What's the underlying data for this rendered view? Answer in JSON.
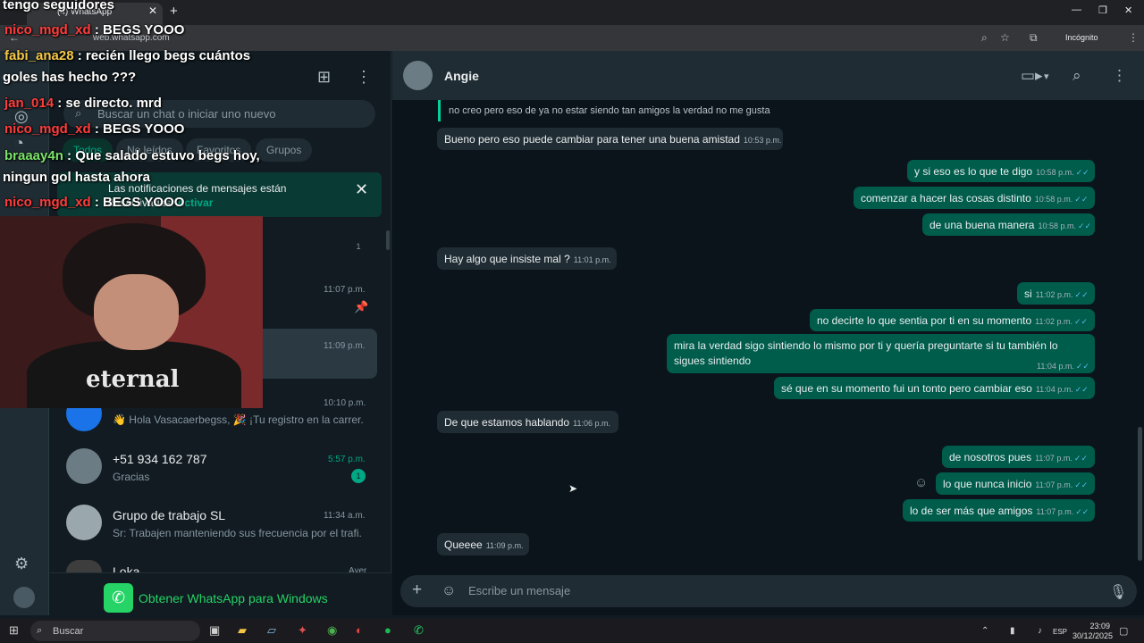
{
  "browser": {
    "tab_title": "(4) WhatsApp",
    "url": "web.whatsapp.com",
    "incognito_label": "Incógnito"
  },
  "sidebar": {
    "search_placeholder": "Buscar un chat o iniciar uno nuevo",
    "filters": [
      "Todos",
      "No leídos",
      "Favoritos",
      "Grupos"
    ],
    "notification": {
      "text": "Las notificaciones de mensajes están",
      "text2": "desactivadas.",
      "action": "Activar"
    },
    "chats": [
      {
        "time": "",
        "badge": "1"
      },
      {
        "time": "11:07 p.m."
      },
      {
        "time": "11:09 p.m."
      },
      {
        "time": "10:10 p.m.",
        "message": "👋 Hola Vasacaerbegss, 🎉 ¡Tu registro en la carrer..."
      },
      {
        "name": "+51 934 162 787",
        "time": "5:57 p.m.",
        "message": "Gracias",
        "badge": "1"
      },
      {
        "name": "Grupo de trabajo SL",
        "time": "11:34 a.m.",
        "message": "Sr: Trabajen manteniendo sus frecuencia por el trafi..."
      },
      {
        "name": "Loka",
        "time": "Ayer"
      }
    ],
    "get_app": "Obtener WhatsApp para Windows"
  },
  "conversation": {
    "contact_name": "Angie",
    "quoted": "no creo pero eso de ya no estar siendo tan amigos la verdad no me gusta",
    "messages": [
      {
        "dir": "in",
        "text": "Bueno pero eso puede cambiar para tener una buena amistad",
        "time": "10:53 p.m."
      },
      {
        "dir": "out",
        "text": "y si eso es lo que te digo",
        "time": "10:58 p.m."
      },
      {
        "dir": "out",
        "text": "comenzar a hacer las cosas distinto",
        "time": "10:58 p.m."
      },
      {
        "dir": "out",
        "text": "de una buena manera",
        "time": "10:58 p.m."
      },
      {
        "dir": "in",
        "text": "Hay algo que insiste mal ?",
        "time": "11:01 p.m."
      },
      {
        "dir": "out",
        "text": "si",
        "time": "11:02 p.m."
      },
      {
        "dir": "out",
        "text": "no decirte lo que sentia por ti en su momento",
        "time": "11:02 p.m."
      },
      {
        "dir": "out",
        "text": "mira la verdad sigo sintiendo lo mismo por ti y quería preguntarte si tu también lo",
        "text2": "sigues sintiendo",
        "time": "11:04 p.m."
      },
      {
        "dir": "out",
        "text": "sé que en su momento fui un tonto pero cambiar eso",
        "time": "11:04 p.m."
      },
      {
        "dir": "in",
        "text": "De que estamos hablando",
        "time": "11:06 p.m."
      },
      {
        "dir": "out",
        "text": "de nosotros pues",
        "time": "11:07 p.m."
      },
      {
        "dir": "out",
        "text": "lo que nunca inicio",
        "time": "11:07 p.m."
      },
      {
        "dir": "out",
        "text": "lo de ser más que amigos",
        "time": "11:07 p.m."
      },
      {
        "dir": "in",
        "text": "Queeee",
        "time": "11:09 p.m."
      }
    ],
    "composer_placeholder": "Escribe un mensaje"
  },
  "stream_overlay": {
    "lines": [
      {
        "user": "",
        "text": "tengo seguidores"
      },
      {
        "user": "nico_mgd_xd",
        "text": " : BEGS YOOO"
      },
      {
        "user": "fabi_ana28",
        "text": " : recién llego begs cuántos"
      },
      {
        "user": "",
        "text": "goles has hecho ???"
      },
      {
        "user": "jan_014",
        "text": " : se directo. mrd"
      },
      {
        "user": "nico_mgd_xd",
        "text": " : BEGS YOOO"
      },
      {
        "user": "braaay4n",
        "text": " : Que salado estuvo begs hoy,"
      },
      {
        "user": "",
        "text": "ningun gol hasta ahora"
      },
      {
        "user": "nico_mgd_xd",
        "text": " : BEGS YOOO"
      }
    ],
    "webcam_shirt_text": "eternal"
  },
  "taskbar": {
    "search_label": "Buscar",
    "lang": "ESP",
    "time": "23:09",
    "date": "30/12/2025"
  }
}
